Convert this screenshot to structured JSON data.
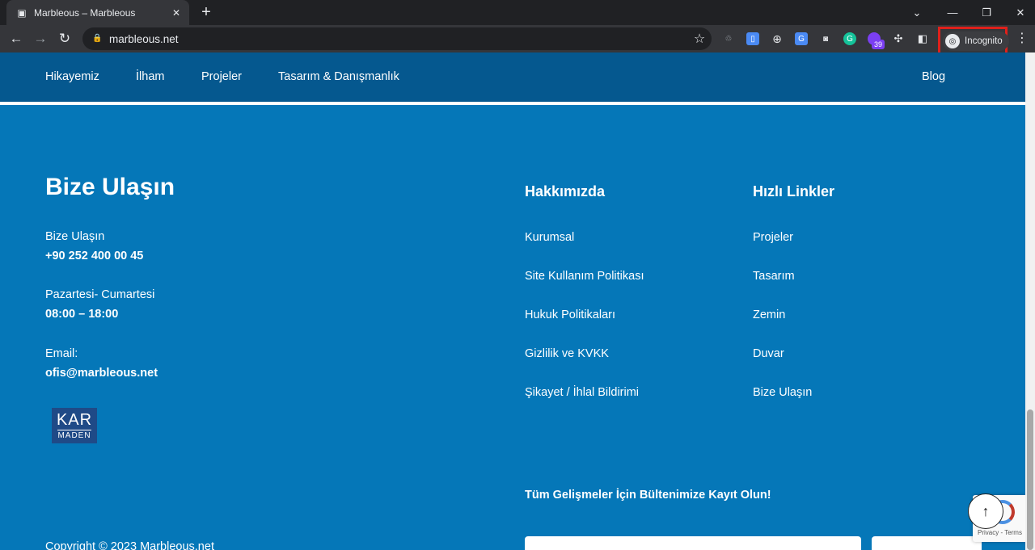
{
  "browser": {
    "tab_title": "Marbleous – Marbleous",
    "tab_close": "✕",
    "new_tab": "+",
    "url": "marbleous.net",
    "incognito_label": "Incognito",
    "extension_badge": "39",
    "win_chevron": "⌄",
    "win_minimize": "—",
    "win_restore": "❐",
    "win_close": "✕"
  },
  "nav": {
    "items": [
      "Hikayemiz",
      "İlham",
      "Projeler",
      "Tasarım & Danışmanlık"
    ],
    "blog": "Blog"
  },
  "contact": {
    "title": "Bize Ulaşın",
    "phone_label": "Bize Ulaşın",
    "phone_value": "+90 252 400 00 45",
    "hours_label": "Pazartesi- Cumartesi",
    "hours_value": "08:00 – 18:00",
    "email_label": "Email:",
    "email_value": "ofis@marbleous.net",
    "logo_top": "KAR",
    "logo_bottom": "MADEN"
  },
  "about": {
    "title": "Hakkımızda",
    "links": [
      "Kurumsal",
      "Site Kullanım Politikası",
      "Hukuk Politikaları",
      "Gizlilik ve KVKK",
      "Şikayet / İhlal Bildirimi"
    ]
  },
  "quick_links": {
    "title": "Hızlı Linkler",
    "links": [
      "Projeler",
      "Tasarım",
      "Zemin",
      "Duvar",
      "Bize Ulaşın"
    ]
  },
  "newsletter": {
    "title": "Tüm Gelişmeler İçin Bültenimize Kayıt Olun!"
  },
  "footer": {
    "copyright": "Copyright © 2023 Marbleous.net"
  },
  "recaptcha": {
    "text": "Privacy - Terms"
  },
  "icons": {
    "back": "back-arrow-icon",
    "forward": "forward-arrow-icon",
    "reload": "reload-icon",
    "lock": "lock-icon",
    "star": "bookmark-star-icon",
    "scroll_top": "arrow-up-icon"
  },
  "colors": {
    "footer_bg": "#0577b8",
    "nav_bg": "#05588f",
    "text": "#ffffff",
    "highlight": "#e0201b"
  }
}
